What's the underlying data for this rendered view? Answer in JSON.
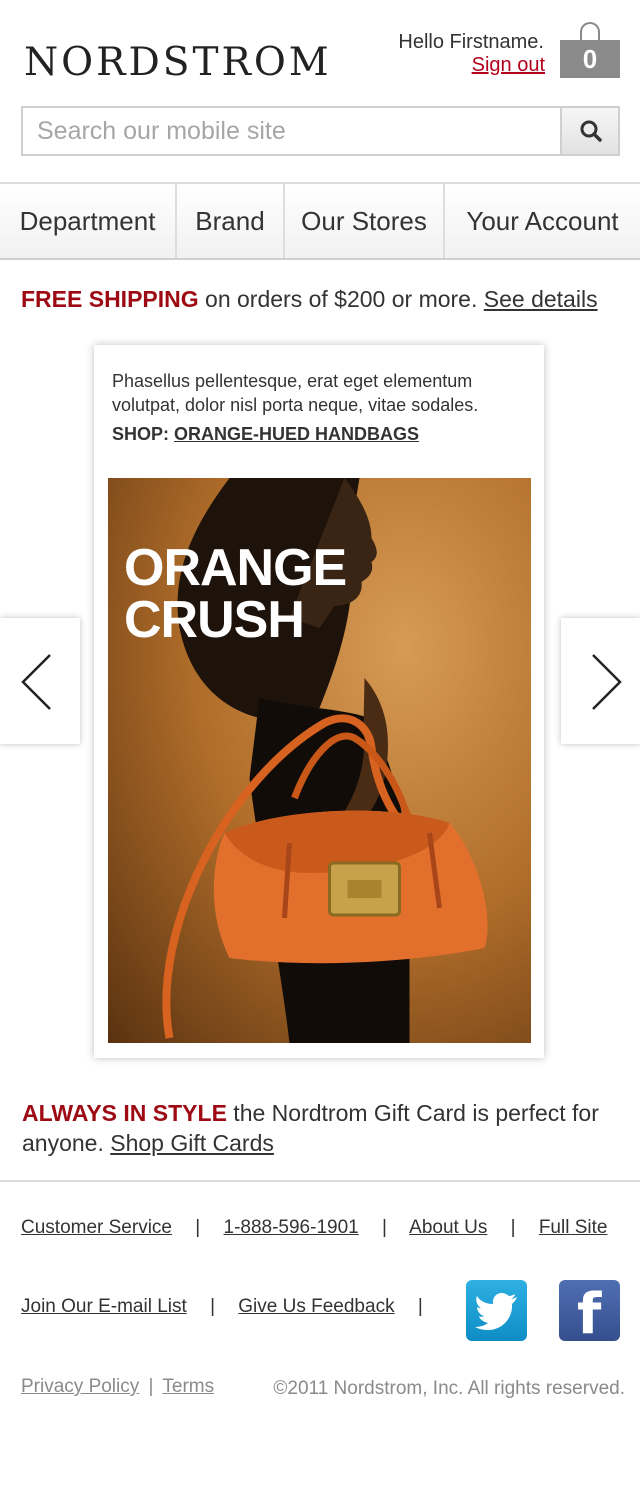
{
  "header": {
    "logo": "NORDSTROM",
    "greeting": "Hello Firstname.",
    "sign_out": "Sign out",
    "cart_count": "0"
  },
  "search": {
    "placeholder": "Search our mobile site",
    "icon": "search-icon"
  },
  "nav": {
    "items": [
      {
        "label": "Department"
      },
      {
        "label": "Brand"
      },
      {
        "label": "Our Stores"
      },
      {
        "label": "Your Account"
      }
    ]
  },
  "promo": {
    "highlight": "FREE SHIPPING",
    "text": " on orders of $200 or more. ",
    "link": "See details"
  },
  "feature": {
    "description": "Phasellus pellentesque, erat eget elementum volutpat, dolor nisl porta neque, vitae sodales.",
    "shop_label": "SHOP: ",
    "shop_link": "ORANGE-HUED HANDBAGS",
    "hero_line1": "ORANGE",
    "hero_line2": "CRUSH"
  },
  "carousel": {
    "prev_icon": "chevron-left-icon",
    "next_icon": "chevron-right-icon"
  },
  "gift": {
    "highlight": "ALWAYS IN STYLE",
    "text": " the Nordtrom Gift Card is perfect for anyone. ",
    "link": "Shop Gift Cards"
  },
  "footer": {
    "customer_service": "Customer Service",
    "phone": "1-888-596-1901",
    "about": "About Us",
    "full_site": "Full Site",
    "email_list": "Join Our E-mail List",
    "feedback": "Give Us Feedback",
    "separator": "|",
    "privacy": "Privacy Policy",
    "terms": "Terms",
    "copyright": "©2011 Nordstrom, Inc. All rights reserved.",
    "twitter_icon": "twitter-icon",
    "facebook_icon": "facebook-icon",
    "facebook_letter": "f"
  },
  "colors": {
    "accent_red": "#9d0a13",
    "link_red": "#b3001b",
    "twitter_blue": "#1a9fd6",
    "facebook_blue": "#3b5998"
  }
}
